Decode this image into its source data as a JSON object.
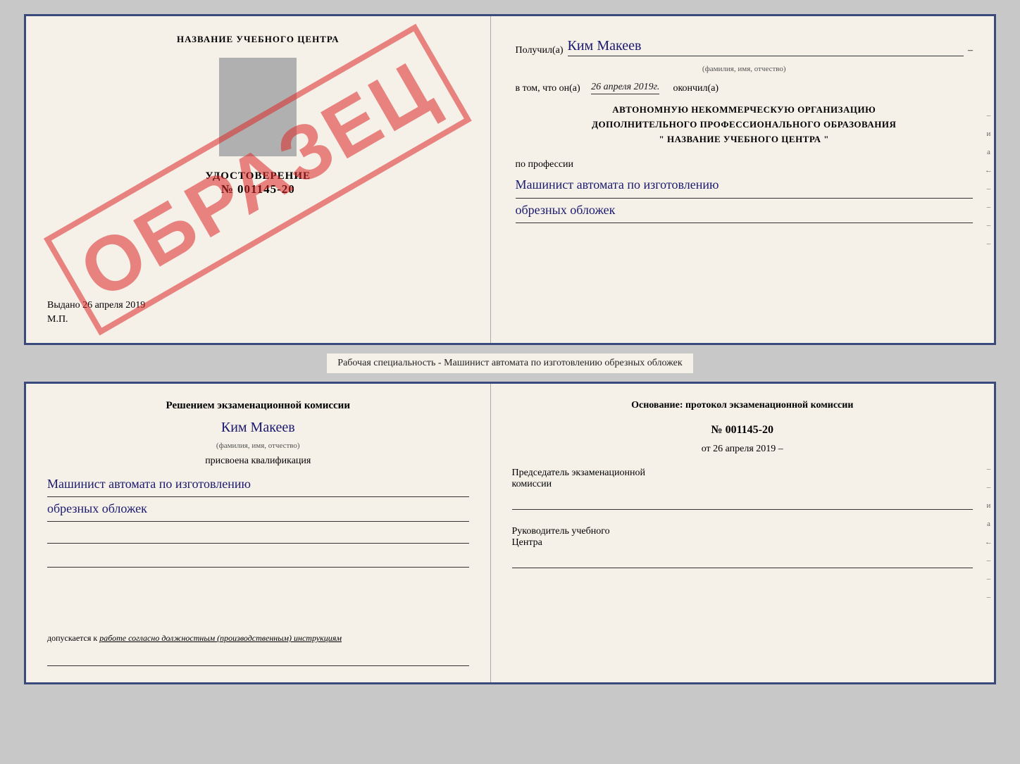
{
  "top_cert": {
    "left": {
      "title": "НАЗВАНИЕ УЧЕБНОГО ЦЕНТРА",
      "watermark": "ОБРАЗЕЦ",
      "udostoverenie_label": "УДОСТОВЕРЕНИЕ",
      "number": "№ 001145-20",
      "vydano_label": "Выдано",
      "vydano_date": "26 апреля 2019",
      "mp": "М.П."
    },
    "right": {
      "poluchil": "Получил(а)",
      "name": "Ким Макеев",
      "name_sublabel": "(фамилия, имя, отчество)",
      "vtom_prefix": "в том, что он(а)",
      "date": "26 апреля 2019г.",
      "okonchil": "окончил(а)",
      "org_line1": "АВТОНОМНУЮ НЕКОММЕРЧЕСКУЮ ОРГАНИЗАЦИЮ",
      "org_line2": "ДОПОЛНИТЕЛЬНОГО ПРОФЕССИОНАЛЬНОГО ОБРАЗОВАНИЯ",
      "org_line3": "\"  НАЗВАНИЕ УЧЕБНОГО ЦЕНТРА  \"",
      "po_professii": "по профессии",
      "profession_line1": "Машинист автомата по изготовлению",
      "profession_line2": "обрезных обложек"
    }
  },
  "middle_label": "Рабочая специальность - Машинист автомата по изготовлению обрезных обложек",
  "bottom_cert": {
    "left": {
      "resheniem": "Решением экзаменационной комиссии",
      "name": "Ким Макеев",
      "fio_sublabel": "(фамилия, имя, отчество)",
      "prisvoena": "присвоена квалификация",
      "kvali_line1": "Машинист автомата по изготовлению",
      "kvali_line2": "обрезных обложек",
      "dopuskaetsya_prefix": "допускается к",
      "dopuskaetsya_italic": "работе согласно должностным (производственным) инструкциям"
    },
    "right": {
      "osnovanie": "Основание: протокол экзаменационной комиссии",
      "number": "№  001145-20",
      "ot_prefix": "от",
      "ot_date": "26 апреля 2019",
      "chairman_label1": "Председатель экзаменационной",
      "chairman_label2": "комиссии",
      "rukovoditel_label1": "Руководитель учебного",
      "rukovoditel_label2": "Центра"
    }
  }
}
